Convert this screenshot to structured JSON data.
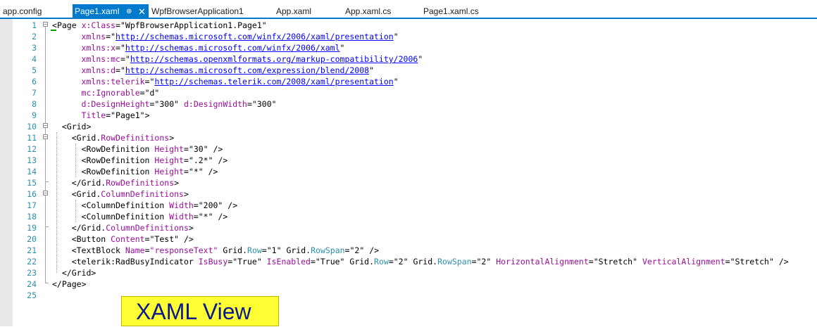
{
  "tabs": [
    {
      "label": "app.config",
      "active": false
    },
    {
      "label": "Page1.xaml",
      "active": true,
      "pin_glyph": "⊕",
      "close_glyph": "✕"
    },
    {
      "label": "WpfBrowserApplication1",
      "active": false
    },
    {
      "label": "App.xaml",
      "active": false
    },
    {
      "label": "App.xaml.cs",
      "active": false
    },
    {
      "label": "Page1.xaml.cs",
      "active": false
    }
  ],
  "line_numbers": [
    "1",
    "2",
    "3",
    "4",
    "5",
    "6",
    "7",
    "8",
    "9",
    "10",
    "11",
    "12",
    "13",
    "14",
    "15",
    "16",
    "17",
    "18",
    "19",
    "20",
    "21",
    "22",
    "23",
    "24",
    "25"
  ],
  "code_lines": [
    [
      [
        "p",
        "<"
      ],
      [
        "el",
        "Page "
      ],
      [
        "attr",
        "x:Class"
      ],
      [
        "p",
        "="
      ],
      [
        "s",
        "\"WpfBrowserApplication1.Page1\""
      ]
    ],
    [
      [
        "p",
        "      "
      ],
      [
        "attr",
        "xmlns"
      ],
      [
        "p",
        "="
      ],
      [
        "s",
        "\""
      ],
      [
        "link",
        "http://schemas.microsoft.com/winfx/2006/xaml/presentation"
      ],
      [
        "s",
        "\""
      ]
    ],
    [
      [
        "p",
        "      "
      ],
      [
        "attr",
        "xmlns:x"
      ],
      [
        "p",
        "="
      ],
      [
        "s",
        "\""
      ],
      [
        "link",
        "http://schemas.microsoft.com/winfx/2006/xaml"
      ],
      [
        "s",
        "\""
      ]
    ],
    [
      [
        "p",
        "      "
      ],
      [
        "attr",
        "xmlns:mc"
      ],
      [
        "p",
        "="
      ],
      [
        "s",
        "\""
      ],
      [
        "link",
        "http://schemas.openxmlformats.org/markup-compatibility/2006"
      ],
      [
        "s",
        "\""
      ]
    ],
    [
      [
        "p",
        "      "
      ],
      [
        "attr",
        "xmlns:d"
      ],
      [
        "p",
        "="
      ],
      [
        "s",
        "\""
      ],
      [
        "link",
        "http://schemas.microsoft.com/expression/blend/2008"
      ],
      [
        "s",
        "\""
      ]
    ],
    [
      [
        "p",
        "      "
      ],
      [
        "attr",
        "xmlns:telerik"
      ],
      [
        "p",
        "="
      ],
      [
        "s",
        "\""
      ],
      [
        "link",
        "http://schemas.telerik.com/2008/xaml/presentation"
      ],
      [
        "s",
        "\""
      ]
    ],
    [
      [
        "p",
        "      "
      ],
      [
        "attr",
        "mc:Ignorable"
      ],
      [
        "p",
        "="
      ],
      [
        "s",
        "\"d\""
      ]
    ],
    [
      [
        "p",
        "      "
      ],
      [
        "attr",
        "d:DesignHeight"
      ],
      [
        "p",
        "="
      ],
      [
        "s",
        "\"300\" "
      ],
      [
        "attr",
        "d:DesignWidth"
      ],
      [
        "p",
        "="
      ],
      [
        "s",
        "\"300\""
      ]
    ],
    [
      [
        "p",
        "      "
      ],
      [
        "attr",
        "Title"
      ],
      [
        "p",
        "="
      ],
      [
        "s",
        "\"Page1\""
      ],
      [
        "p",
        ">"
      ]
    ],
    [
      [
        "p",
        "  <"
      ],
      [
        "el",
        "Grid"
      ],
      [
        "p",
        ">"
      ]
    ],
    [
      [
        "p",
        "    <"
      ],
      [
        "el",
        "Grid"
      ],
      [
        "p",
        "."
      ],
      [
        "attr",
        "RowDefinitions"
      ],
      [
        "p",
        ">"
      ]
    ],
    [
      [
        "p",
        "      <"
      ],
      [
        "el",
        "RowDefinition "
      ],
      [
        "attr",
        "Height"
      ],
      [
        "p",
        "="
      ],
      [
        "s",
        "\"30\" "
      ],
      [
        "p",
        "/>"
      ]
    ],
    [
      [
        "p",
        "      <"
      ],
      [
        "el",
        "RowDefinition "
      ],
      [
        "attr",
        "Height"
      ],
      [
        "p",
        "="
      ],
      [
        "s",
        "\".2*\" "
      ],
      [
        "p",
        "/>"
      ]
    ],
    [
      [
        "p",
        "      <"
      ],
      [
        "el",
        "RowDefinition "
      ],
      [
        "attr",
        "Height"
      ],
      [
        "p",
        "="
      ],
      [
        "s",
        "\"*\" "
      ],
      [
        "p",
        "/>"
      ]
    ],
    [
      [
        "p",
        "    </"
      ],
      [
        "el",
        "Grid"
      ],
      [
        "p",
        "."
      ],
      [
        "attr",
        "RowDefinitions"
      ],
      [
        "p",
        ">"
      ]
    ],
    [
      [
        "p",
        "    <"
      ],
      [
        "el",
        "Grid"
      ],
      [
        "p",
        "."
      ],
      [
        "attr",
        "ColumnDefinitions"
      ],
      [
        "p",
        ">"
      ]
    ],
    [
      [
        "p",
        "      <"
      ],
      [
        "el",
        "ColumnDefinition "
      ],
      [
        "attr",
        "Width"
      ],
      [
        "p",
        "="
      ],
      [
        "s",
        "\"200\" "
      ],
      [
        "p",
        "/>"
      ]
    ],
    [
      [
        "p",
        "      <"
      ],
      [
        "el",
        "ColumnDefinition "
      ],
      [
        "attr",
        "Width"
      ],
      [
        "p",
        "="
      ],
      [
        "s",
        "\"*\" "
      ],
      [
        "p",
        "/>"
      ]
    ],
    [
      [
        "p",
        "    </"
      ],
      [
        "el",
        "Grid"
      ],
      [
        "p",
        "."
      ],
      [
        "attr",
        "ColumnDefinitions"
      ],
      [
        "p",
        ">"
      ]
    ],
    [
      [
        "p",
        "    <"
      ],
      [
        "el",
        "Button "
      ],
      [
        "attr",
        "Content"
      ],
      [
        "p",
        "="
      ],
      [
        "s",
        "\"Test\" "
      ],
      [
        "p",
        "/>"
      ]
    ],
    [
      [
        "p",
        "    <"
      ],
      [
        "el",
        "TextBlock "
      ],
      [
        "attr",
        "Name"
      ],
      [
        "p",
        "="
      ],
      [
        "attr",
        "\"responseText\""
      ],
      [
        "p",
        " "
      ],
      [
        "el",
        "Grid"
      ],
      [
        "p",
        "."
      ],
      [
        "prop",
        "Row"
      ],
      [
        "p",
        "="
      ],
      [
        "s",
        "\"1\" "
      ],
      [
        "el",
        "Grid"
      ],
      [
        "p",
        "."
      ],
      [
        "prop",
        "RowSpan"
      ],
      [
        "p",
        "="
      ],
      [
        "s",
        "\"2\" "
      ],
      [
        "p",
        "/>"
      ]
    ],
    [
      [
        "p",
        "    <"
      ],
      [
        "el",
        "telerik:RadBusyIndicator "
      ],
      [
        "attr",
        "IsBusy"
      ],
      [
        "p",
        "="
      ],
      [
        "s",
        "\"True\" "
      ],
      [
        "attr",
        "IsEnabled"
      ],
      [
        "p",
        "="
      ],
      [
        "s",
        "\"True\" "
      ],
      [
        "el",
        "Grid"
      ],
      [
        "p",
        "."
      ],
      [
        "prop",
        "Row"
      ],
      [
        "p",
        "="
      ],
      [
        "s",
        "\"2\" "
      ],
      [
        "el",
        "Grid"
      ],
      [
        "p",
        "."
      ],
      [
        "prop",
        "RowSpan"
      ],
      [
        "p",
        "="
      ],
      [
        "s",
        "\"2\" "
      ],
      [
        "attr",
        "HorizontalAlignment"
      ],
      [
        "p",
        "="
      ],
      [
        "s",
        "\"Stretch\" "
      ],
      [
        "attr",
        "VerticalAlignment"
      ],
      [
        "p",
        "="
      ],
      [
        "s",
        "\"Stretch\" "
      ],
      [
        "p",
        "/>"
      ]
    ],
    [
      [
        "p",
        "  </"
      ],
      [
        "el",
        "Grid"
      ],
      [
        "p",
        ">"
      ]
    ],
    [
      [
        "p",
        "</"
      ],
      [
        "el",
        "Page"
      ],
      [
        "p",
        ">"
      ]
    ],
    []
  ],
  "overlay_label": "XAML View",
  "colors": {
    "tab_active_bg": "#007acc",
    "line_number": "#2b91af",
    "attribute": "#9b0e9b",
    "property": "#2b91af",
    "link": "#0000ff",
    "badge_bg": "#ffff33",
    "badge_text": "#0a1a8c"
  }
}
